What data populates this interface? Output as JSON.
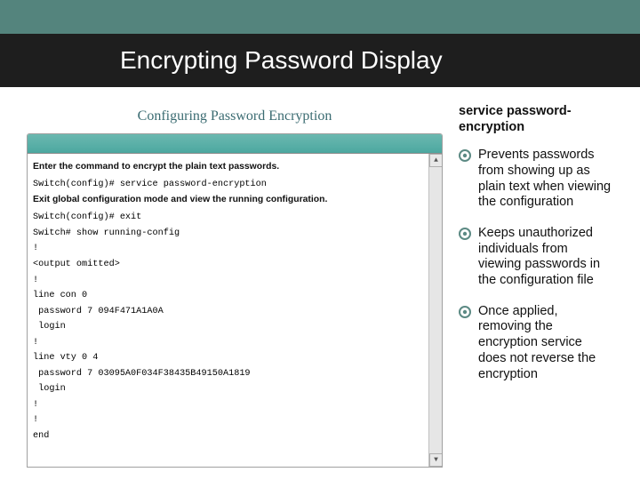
{
  "slide": {
    "title": "Encrypting Password Display",
    "window_header": "Configuring Password Encryption",
    "terminal_lines": [
      {
        "type": "instruction",
        "text": "Enter the command to encrypt the plain text passwords."
      },
      {
        "type": "cmd",
        "text": "Switch(config)# service password-encryption"
      },
      {
        "type": "instruction",
        "text": "Exit global configuration mode and view the running configuration."
      },
      {
        "type": "cmd",
        "text": "Switch(config)# exit"
      },
      {
        "type": "cmd",
        "text": "Switch# show running-config"
      },
      {
        "type": "cmd",
        "text": "!"
      },
      {
        "type": "cmd",
        "text": "<output omitted>"
      },
      {
        "type": "cmd",
        "text": "!"
      },
      {
        "type": "cmd",
        "text": "line con 0"
      },
      {
        "type": "cmd",
        "text": " password 7 094F471A1A0A"
      },
      {
        "type": "cmd",
        "text": " login"
      },
      {
        "type": "cmd",
        "text": "!"
      },
      {
        "type": "cmd",
        "text": "line vty 0 4"
      },
      {
        "type": "cmd",
        "text": " password 7 03095A0F034F38435B49150A1819"
      },
      {
        "type": "cmd",
        "text": " login"
      },
      {
        "type": "cmd",
        "text": "!"
      },
      {
        "type": "cmd",
        "text": "!"
      },
      {
        "type": "cmd",
        "text": "end"
      }
    ],
    "command_title": "service password-encryption",
    "bullets": [
      "Prevents passwords from showing up as plain text when viewing the configuration",
      "Keeps unauthorized individuals from viewing passwords in the configuration file",
      "Once applied, removing the encryption service does not reverse the encryption"
    ],
    "scroll_up": "▲",
    "scroll_down": "▼"
  }
}
